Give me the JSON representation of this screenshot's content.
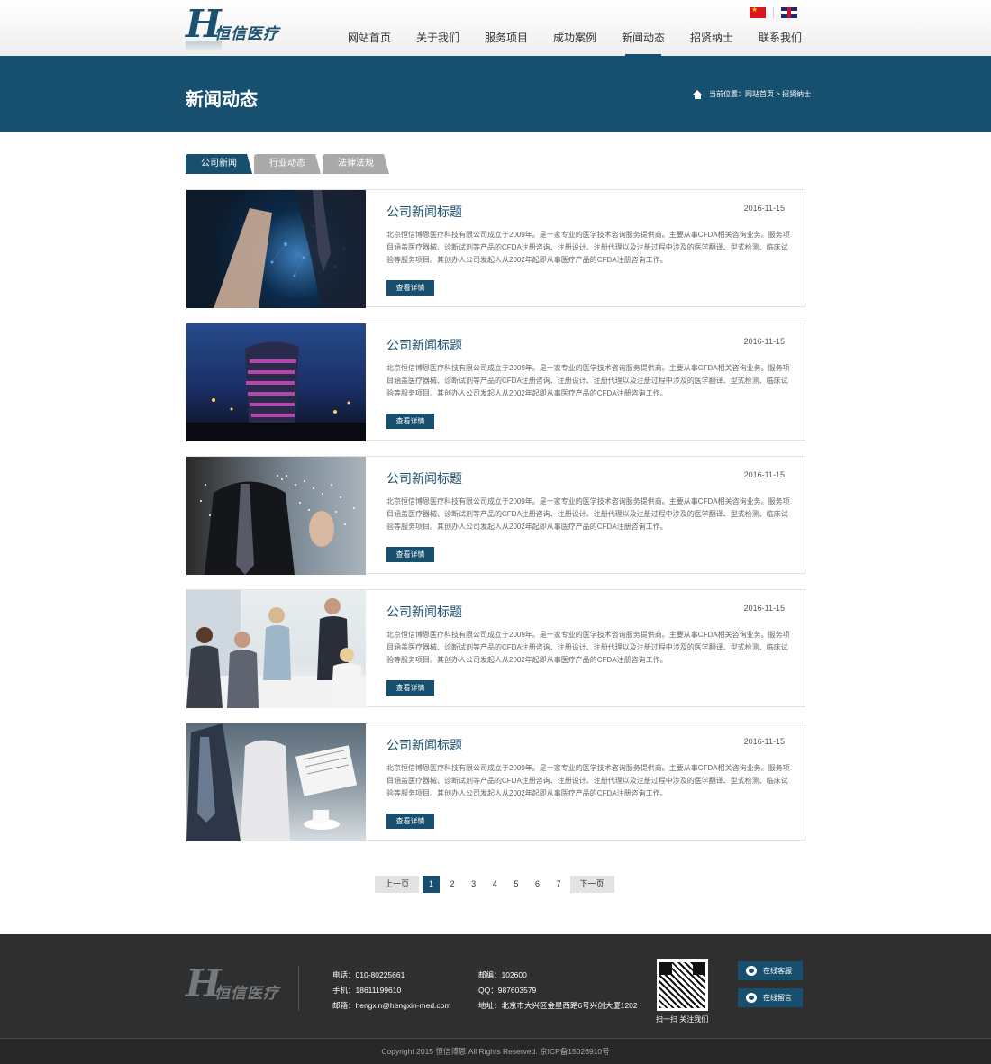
{
  "header": {
    "logo_mark": "H",
    "logo_text": "恒信医疗",
    "nav": [
      "网站首页",
      "关于我们",
      "服务项目",
      "成功案例",
      "新闻动态",
      "招贤纳士",
      "联系我们"
    ],
    "active_nav": 4
  },
  "banner": {
    "title": "新闻动态",
    "breadcrumb": "当前位置：网站首页 > 招贤纳士"
  },
  "tabs": [
    "公司新闻",
    "行业动态",
    "法律法规"
  ],
  "news": [
    {
      "title": "公司新闻标题",
      "date": "2016-11-15",
      "summary": "北京恒信博恩医疗科技有限公司成立于2009年。是一家专业的医学技术咨询服务提供商。主要从事CFDA相关咨询业务。服务项目涵盖医疗器械、诊断试剂等产品的CFDA注册咨询、注册设计、注册代理以及注册过程中涉及的医学翻译、型式检测、临床试验等服务项目。其创办人公司发起人从2002年起即从事医疗产品的CFDA注册咨询工作。",
      "button": "查看详情"
    },
    {
      "title": "公司新闻标题",
      "date": "2016-11-15",
      "summary": "北京恒信博恩医疗科技有限公司成立于2009年。是一家专业的医学技术咨询服务提供商。主要从事CFDA相关咨询业务。服务项目涵盖医疗器械、诊断试剂等产品的CFDA注册咨询、注册设计、注册代理以及注册过程中涉及的医学翻译、型式检测、临床试验等服务项目。其创办人公司发起人从2002年起即从事医疗产品的CFDA注册咨询工作。",
      "button": "查看详情"
    },
    {
      "title": "公司新闻标题",
      "date": "2016-11-15",
      "summary": "北京恒信博恩医疗科技有限公司成立于2009年。是一家专业的医学技术咨询服务提供商。主要从事CFDA相关咨询业务。服务项目涵盖医疗器械、诊断试剂等产品的CFDA注册咨询、注册设计、注册代理以及注册过程中涉及的医学翻译、型式检测、临床试验等服务项目。其创办人公司发起人从2002年起即从事医疗产品的CFDA注册咨询工作。",
      "button": "查看详情"
    },
    {
      "title": "公司新闻标题",
      "date": "2016-11-15",
      "summary": "北京恒信博恩医疗科技有限公司成立于2009年。是一家专业的医学技术咨询服务提供商。主要从事CFDA相关咨询业务。服务项目涵盖医疗器械、诊断试剂等产品的CFDA注册咨询、注册设计、注册代理以及注册过程中涉及的医学翻译、型式检测、临床试验等服务项目。其创办人公司发起人从2002年起即从事医疗产品的CFDA注册咨询工作。",
      "button": "查看详情"
    },
    {
      "title": "公司新闻标题",
      "date": "2016-11-15",
      "summary": "北京恒信博恩医疗科技有限公司成立于2009年。是一家专业的医学技术咨询服务提供商。主要从事CFDA相关咨询业务。服务项目涵盖医疗器械、诊断试剂等产品的CFDA注册咨询、注册设计、注册代理以及注册过程中涉及的医学翻译、型式检测、临床试验等服务项目。其创办人公司发起人从2002年起即从事医疗产品的CFDA注册咨询工作。",
      "button": "查看详情"
    }
  ],
  "pagination": {
    "prev": "上一页",
    "pages": [
      "1",
      "2",
      "3",
      "4",
      "5",
      "6",
      "7"
    ],
    "current": "1",
    "next": "下一页"
  },
  "footer": {
    "logo_mark": "H",
    "logo_text": "恒信医疗",
    "contact_left": [
      "电话：010-80225661",
      "手机：18611199610",
      "邮箱：hengxin@hengxin-med.com"
    ],
    "contact_right": [
      "邮编：102600",
      "QQ：987603579",
      "地址：北京市大兴区金星西路6号兴创大厦1202"
    ],
    "qr_caption": "扫一扫 关注我们",
    "service_buttons": [
      "在线客服",
      "在线留言"
    ],
    "copyright": "Copyright 2015 恒信博恩 All Rights Reserved. 京ICP备15026910号"
  },
  "colors": {
    "primary": "#174f6f",
    "footer_bg": "#2f2f2f",
    "tab_inactive": "#aaaaaa"
  }
}
